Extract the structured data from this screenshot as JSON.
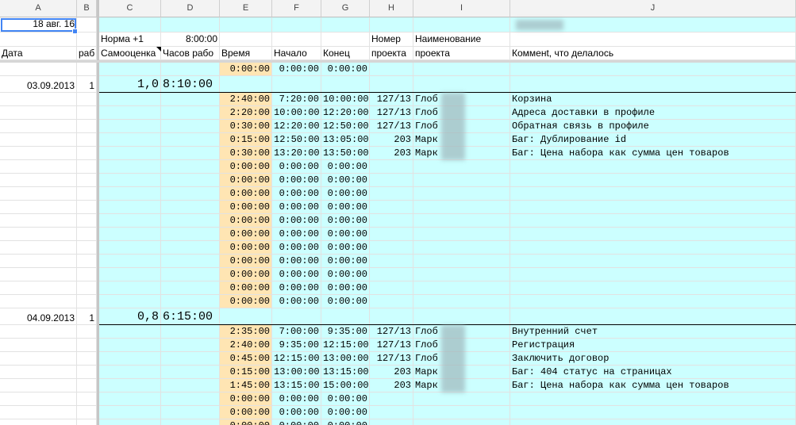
{
  "column_headers": [
    "A",
    "B",
    "C",
    "D",
    "E",
    "F",
    "G",
    "H",
    "I",
    "J"
  ],
  "top": {
    "a1_date": "18 авг. 16",
    "norm_label": "Норма +1",
    "norm_value": "8:00:00",
    "h_num_line1": "Номер",
    "i_name_line1": "Наименование"
  },
  "headers": {
    "a": "Дата",
    "b": "раб",
    "c": "Самооценка",
    "d": "Часов рабо",
    "e": "Время",
    "f": "Начало",
    "g": "Конец",
    "h": "проекта",
    "i": "проекта",
    "j": "Комменt, что делалось"
  },
  "days": [
    {
      "date": "03.09.2013",
      "work": "1",
      "self_eval": "1,0",
      "hours": "8:10:00",
      "pre_row": {
        "time": "0:00:00",
        "start": "0:00:00",
        "end": "0:00:00"
      },
      "rows": [
        {
          "time": "2:40:00",
          "start": "7:20:00",
          "end": "10:00:00",
          "proj": "127/13",
          "name": "Глоб",
          "comment": "Корзина"
        },
        {
          "time": "2:20:00",
          "start": "10:00:00",
          "end": "12:20:00",
          "proj": "127/13",
          "name": "Глоб",
          "comment": "Адреса доставки в профиле"
        },
        {
          "time": "0:30:00",
          "start": "12:20:00",
          "end": "12:50:00",
          "proj": "127/13",
          "name": "Глоб",
          "comment": "Обратная связь в профиле"
        },
        {
          "time": "0:15:00",
          "start": "12:50:00",
          "end": "13:05:00",
          "proj": "203",
          "name": "Марк",
          "comment": "Баг: Дублирование id"
        },
        {
          "time": "0:30:00",
          "start": "13:20:00",
          "end": "13:50:00",
          "proj": "203",
          "name": "Марк",
          "comment": "Баг: Цена набора как сумма цен товаров"
        },
        {
          "time": "0:00:00",
          "start": "0:00:00",
          "end": "0:00:00",
          "proj": "",
          "name": "",
          "comment": ""
        },
        {
          "time": "0:00:00",
          "start": "0:00:00",
          "end": "0:00:00",
          "proj": "",
          "name": "",
          "comment": ""
        },
        {
          "time": "0:00:00",
          "start": "0:00:00",
          "end": "0:00:00",
          "proj": "",
          "name": "",
          "comment": ""
        },
        {
          "time": "0:00:00",
          "start": "0:00:00",
          "end": "0:00:00",
          "proj": "",
          "name": "",
          "comment": ""
        },
        {
          "time": "0:00:00",
          "start": "0:00:00",
          "end": "0:00:00",
          "proj": "",
          "name": "",
          "comment": ""
        },
        {
          "time": "0:00:00",
          "start": "0:00:00",
          "end": "0:00:00",
          "proj": "",
          "name": "",
          "comment": ""
        },
        {
          "time": "0:00:00",
          "start": "0:00:00",
          "end": "0:00:00",
          "proj": "",
          "name": "",
          "comment": ""
        },
        {
          "time": "0:00:00",
          "start": "0:00:00",
          "end": "0:00:00",
          "proj": "",
          "name": "",
          "comment": ""
        },
        {
          "time": "0:00:00",
          "start": "0:00:00",
          "end": "0:00:00",
          "proj": "",
          "name": "",
          "comment": ""
        },
        {
          "time": "0:00:00",
          "start": "0:00:00",
          "end": "0:00:00",
          "proj": "",
          "name": "",
          "comment": ""
        },
        {
          "time": "0:00:00",
          "start": "0:00:00",
          "end": "0:00:00",
          "proj": "",
          "name": "",
          "comment": ""
        }
      ]
    },
    {
      "date": "04.09.2013",
      "work": "1",
      "self_eval": "0,8",
      "hours": "6:15:00",
      "rows": [
        {
          "time": "2:35:00",
          "start": "7:00:00",
          "end": "9:35:00",
          "proj": "127/13",
          "name": "Глоб",
          "comment": "Внутренний счет"
        },
        {
          "time": "2:40:00",
          "start": "9:35:00",
          "end": "12:15:00",
          "proj": "127/13",
          "name": "Глоб",
          "comment": "Регистрация"
        },
        {
          "time": "0:45:00",
          "start": "12:15:00",
          "end": "13:00:00",
          "proj": "127/13",
          "name": "Глоб",
          "comment": "Заключить договор"
        },
        {
          "time": "0:15:00",
          "start": "13:00:00",
          "end": "13:15:00",
          "proj": "203",
          "name": "Марк",
          "comment": "Баг: 404 статус на страницах"
        },
        {
          "time": "1:45:00",
          "start": "13:15:00",
          "end": "15:00:00",
          "proj": "203",
          "name": "Марк",
          "comment": "Баг: Цена набора как сумма цен товаров"
        },
        {
          "time": "0:00:00",
          "start": "0:00:00",
          "end": "0:00:00",
          "proj": "",
          "name": "",
          "comment": ""
        },
        {
          "time": "0:00:00",
          "start": "0:00:00",
          "end": "0:00:00",
          "proj": "",
          "name": "",
          "comment": ""
        },
        {
          "time": "0:00:00",
          "start": "0:00:00",
          "end": "0:00:00",
          "proj": "",
          "name": "",
          "comment": ""
        }
      ]
    }
  ],
  "colors": {
    "cyan": "#ccffff",
    "orange": "#ffe5b3",
    "selection": "#4285f4"
  }
}
